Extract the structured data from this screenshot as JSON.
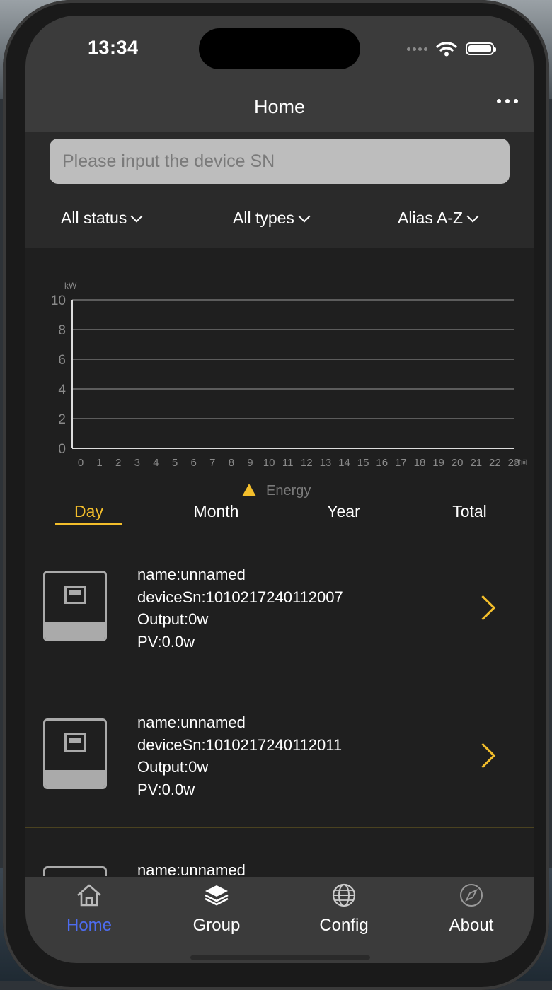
{
  "status_bar": {
    "time": "13:34"
  },
  "nav": {
    "title": "Home",
    "more_icon": "ellipsis-icon"
  },
  "search": {
    "placeholder": "Please input the device SN",
    "value": ""
  },
  "filters": [
    {
      "label": "All status"
    },
    {
      "label": "All types"
    },
    {
      "label": "Alias A-Z"
    }
  ],
  "chart_data": {
    "type": "area",
    "title": "",
    "ylabel": "kW",
    "xlabel": "时间",
    "ylim": [
      0,
      10
    ],
    "yticks": [
      "0",
      "2",
      "4",
      "6",
      "8",
      "10"
    ],
    "categories": [
      "0",
      "1",
      "2",
      "3",
      "4",
      "5",
      "6",
      "7",
      "8",
      "9",
      "10",
      "11",
      "12",
      "13",
      "14",
      "15",
      "16",
      "17",
      "18",
      "19",
      "20",
      "21",
      "22",
      "23"
    ],
    "series": [
      {
        "name": "Energy",
        "color": "#f3be2b",
        "values": []
      }
    ],
    "grid": true,
    "legend": "bottom-center"
  },
  "period_tabs": [
    {
      "label": "Day",
      "active": true
    },
    {
      "label": "Month",
      "active": false
    },
    {
      "label": "Year",
      "active": false
    },
    {
      "label": "Total",
      "active": false
    }
  ],
  "devices": [
    {
      "name": "name:unnamed",
      "sn": "deviceSn:1010217240112007",
      "output": "Output:0w",
      "pv": "PV:0.0w"
    },
    {
      "name": "name:unnamed",
      "sn": "deviceSn:1010217240112011",
      "output": "Output:0w",
      "pv": "PV:0.0w"
    },
    {
      "name": "name:unnamed"
    }
  ],
  "tabbar": [
    {
      "label": "Home",
      "icon": "home-icon",
      "active": true
    },
    {
      "label": "Group",
      "icon": "layers-icon",
      "active": false
    },
    {
      "label": "Config",
      "icon": "globe-icon",
      "active": false
    },
    {
      "label": "About",
      "icon": "compass-icon",
      "active": false
    }
  ],
  "colors": {
    "accent": "#f3be2b",
    "active_tab": "#4d6cf0",
    "header": "#3b3b3b",
    "background": "#1f1f1f"
  }
}
